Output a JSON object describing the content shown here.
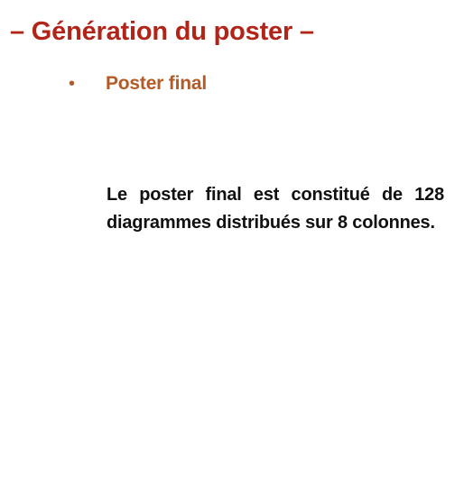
{
  "slide": {
    "title": "– Génération du poster –",
    "bullet": {
      "marker": "•",
      "label": "Poster final"
    },
    "body": "Le poster final est constitué de 128 diagrammes distribués sur 8 colonnes."
  },
  "colors": {
    "title": "#b22418",
    "bullet": "#b65a25",
    "body": "#111111"
  }
}
